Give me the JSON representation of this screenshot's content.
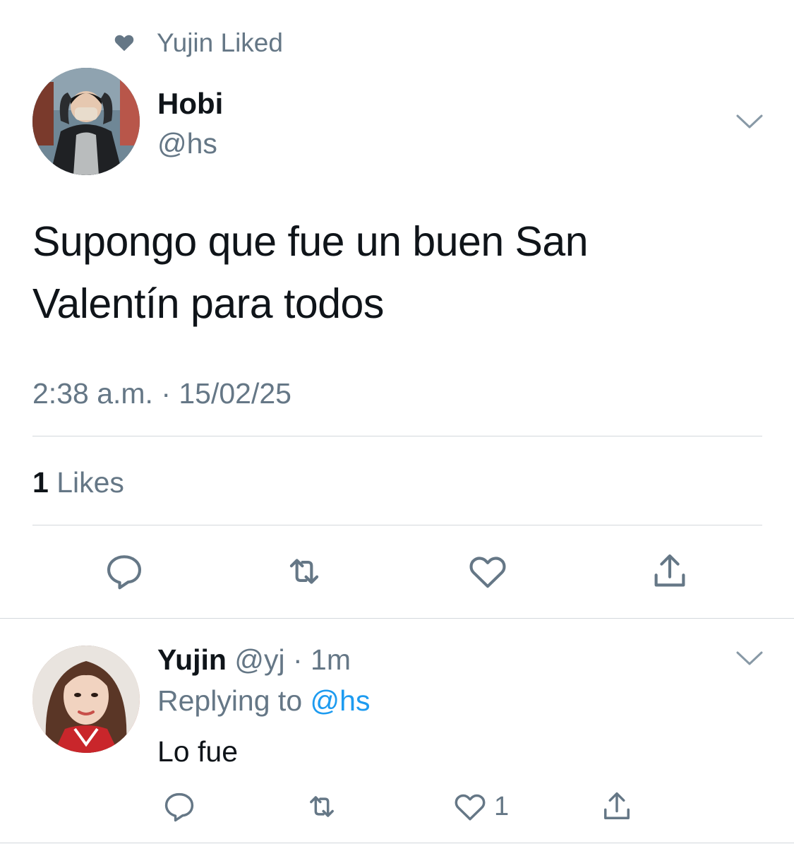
{
  "context": {
    "text": "Yujin Liked",
    "icon": "heart-filled-icon"
  },
  "tweet": {
    "author_name": "Hobi",
    "author_handle": "@hs",
    "text": "Supongo que fue un buen San Valentín para todos",
    "timestamp": "2:38 a.m. · 15/02/25",
    "likes_count": "1",
    "likes_label": "Likes",
    "actions": [
      "reply-icon",
      "retweet-icon",
      "like-icon",
      "share-icon"
    ]
  },
  "reply": {
    "author_name": "Yujin",
    "meta": "@yj · 1m",
    "replying_prefix": "Replying to",
    "replying_handle": "@hs",
    "text": "Lo fue",
    "like_count": "1"
  },
  "colors": {
    "secondary_text": "#657786",
    "link": "#1d9bf0",
    "divider": "#d3d8dc"
  }
}
